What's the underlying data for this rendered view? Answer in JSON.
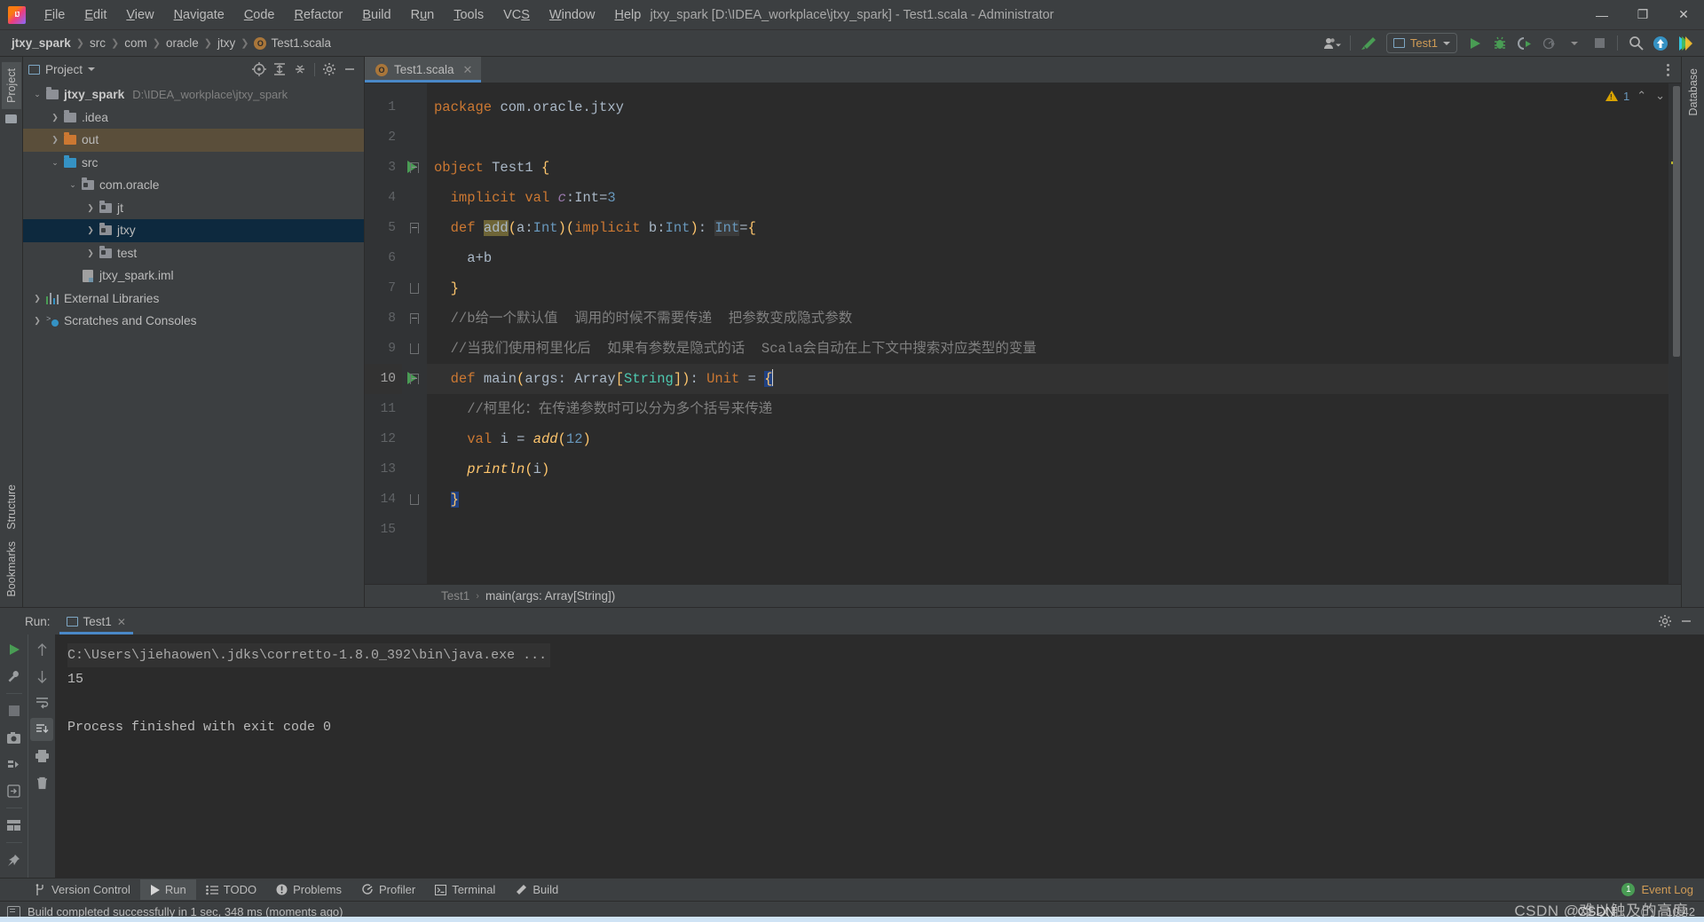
{
  "window": {
    "title": "jtxy_spark [D:\\IDEA_workplace\\jtxy_spark] - Test1.scala - Administrator",
    "minimize": "—",
    "maximize": "❐",
    "close": "✕"
  },
  "menu": [
    {
      "label": "File"
    },
    {
      "label": "Edit"
    },
    {
      "label": "View"
    },
    {
      "label": "Navigate"
    },
    {
      "label": "Code"
    },
    {
      "label": "Refactor"
    },
    {
      "label": "Build"
    },
    {
      "label": "Run"
    },
    {
      "label": "Tools"
    },
    {
      "label": "VCS"
    },
    {
      "label": "Window"
    },
    {
      "label": "Help"
    }
  ],
  "breadcrumbs": [
    {
      "label": "jtxy_spark",
      "bold": true
    },
    {
      "label": "src"
    },
    {
      "label": "com"
    },
    {
      "label": "oracle"
    },
    {
      "label": "jtxy"
    },
    {
      "label": "Test1.scala",
      "icon": "scala-object-icon"
    }
  ],
  "toolbar": {
    "account_icon": "user-account-icon",
    "hammer_icon": "build-hammer-icon",
    "run_config": "Test1",
    "run_icon": "run-icon",
    "debug_icon": "debug-icon",
    "run_coverage_icon": "run-with-coverage-icon",
    "profiler_icon": "profiler-icon",
    "stop_icon": "stop-icon",
    "search_icon": "search-everywhere-icon",
    "update_icon": "update-project-icon",
    "ide_icon": "ide-feature-icon"
  },
  "left_strip": {
    "project_tab": "Project",
    "structure_tab": "Structure",
    "bookmarks_tab": "Bookmarks"
  },
  "right_strip": {
    "database_tab": "Database"
  },
  "project_panel": {
    "title": "Project",
    "icons": [
      "locate-icon",
      "expand-all-icon",
      "collapse-all-icon",
      "settings-gear-icon",
      "hide-icon"
    ],
    "tree": [
      {
        "label": "jtxy_spark",
        "path": "D:\\IDEA_workplace\\jtxy_spark",
        "indent": 0,
        "arrow": "expanded",
        "icon": "project-folder-icon",
        "state": "normal",
        "bold": true
      },
      {
        "label": ".idea",
        "path": "",
        "indent": 1,
        "arrow": "collapsed",
        "icon": "folder-grey-icon",
        "state": "normal",
        "bold": false
      },
      {
        "label": "out",
        "path": "",
        "indent": 1,
        "arrow": "collapsed",
        "icon": "folder-orange-icon",
        "state": "highlight",
        "bold": false
      },
      {
        "label": "src",
        "path": "",
        "indent": 1,
        "arrow": "expanded",
        "icon": "folder-blue-icon",
        "state": "normal",
        "bold": false
      },
      {
        "label": "com.oracle",
        "path": "",
        "indent": 2,
        "arrow": "expanded",
        "icon": "package-icon",
        "state": "normal",
        "bold": false
      },
      {
        "label": "jt",
        "path": "",
        "indent": 3,
        "arrow": "collapsed",
        "icon": "package-icon",
        "state": "normal",
        "bold": false
      },
      {
        "label": "jtxy",
        "path": "",
        "indent": 3,
        "arrow": "collapsed",
        "icon": "package-icon",
        "state": "selected",
        "bold": false
      },
      {
        "label": "test",
        "path": "",
        "indent": 3,
        "arrow": "collapsed",
        "icon": "package-icon",
        "state": "normal",
        "bold": false
      },
      {
        "label": "jtxy_spark.iml",
        "path": "",
        "indent": 2,
        "arrow": "none",
        "icon": "iml-file-icon",
        "state": "normal",
        "bold": false
      },
      {
        "label": "External Libraries",
        "path": "",
        "indent": 0,
        "arrow": "collapsed",
        "icon": "libraries-icon",
        "state": "normal",
        "bold": false
      },
      {
        "label": "Scratches and Consoles",
        "path": "",
        "indent": 0,
        "arrow": "collapsed",
        "icon": "scratches-icon",
        "state": "normal",
        "bold": false
      }
    ]
  },
  "editor": {
    "tab": {
      "label": "Test1.scala",
      "icon": "scala-object-icon",
      "close": "✕"
    },
    "options_icon": "editor-options-icon",
    "inspection": {
      "warning_count": "1",
      "warning_icon": "warning-triangle-icon",
      "up_chevron": "⌃",
      "down_chevron": "⌄"
    },
    "breadcrumb": {
      "class": "Test1",
      "member": "main(args: Array[String])",
      "separator": "›"
    },
    "lines": [
      {
        "no": "1",
        "current": false,
        "runmark": false,
        "fold": "none"
      },
      {
        "no": "2",
        "current": false,
        "runmark": false,
        "fold": "none"
      },
      {
        "no": "3",
        "current": false,
        "runmark": true,
        "fold": "open"
      },
      {
        "no": "4",
        "current": false,
        "runmark": false,
        "fold": "none"
      },
      {
        "no": "5",
        "current": false,
        "runmark": false,
        "fold": "open"
      },
      {
        "no": "6",
        "current": false,
        "runmark": false,
        "fold": "none"
      },
      {
        "no": "7",
        "current": false,
        "runmark": false,
        "fold": "end"
      },
      {
        "no": "8",
        "current": false,
        "runmark": false,
        "fold": "open"
      },
      {
        "no": "9",
        "current": false,
        "runmark": false,
        "fold": "end"
      },
      {
        "no": "10",
        "current": true,
        "runmark": true,
        "fold": "open"
      },
      {
        "no": "11",
        "current": false,
        "runmark": false,
        "fold": "none"
      },
      {
        "no": "12",
        "current": false,
        "runmark": false,
        "fold": "none"
      },
      {
        "no": "13",
        "current": false,
        "runmark": false,
        "fold": "none"
      },
      {
        "no": "14",
        "current": false,
        "runmark": false,
        "fold": "end"
      },
      {
        "no": "15",
        "current": false,
        "runmark": false,
        "fold": "none"
      }
    ],
    "source_text": [
      "package com.oracle.jtxy",
      "",
      "object Test1 {",
      "  implicit val c:Int=3",
      "  def add(a:Int)(implicit b:Int): Int={",
      "    a+b",
      "  }",
      "  //b给一个默认值  调用的时候不需要传递  把参数变成隐式参数",
      "  //当我们使用柯里化后  如果有参数是隐式的话  Scala会自动在上下文中搜索对应类型的变量",
      "  def main(args: Array[String]): Unit = {",
      "    //柯里化：在传递参数时可以分为多个括号来传递",
      "    val i = add(12)",
      "    println(i)",
      "  }"
    ]
  },
  "run_panel": {
    "label": "Run:",
    "tab": {
      "label": "Test1",
      "icon": "run-config-icon",
      "close": "✕"
    },
    "settings_icon": "settings-gear-icon",
    "minimize_icon": "hide-icon",
    "toolbar_left": [
      "rerun-icon",
      "wrench-settings-icon",
      "stop-icon",
      "camera-snapshot-icon",
      "thread-dump-icon",
      "exit-icon",
      "layout-icon",
      "pin-icon"
    ],
    "toolbar_right": [
      "scroll-up-icon",
      "scroll-down-icon",
      "soft-wrap-icon",
      "scroll-to-end-icon",
      "print-icon",
      "trash-icon"
    ],
    "console": [
      {
        "text": "C:\\Users\\jiehaowen\\.jdks\\corretto-1.8.0_392\\bin\\java.exe ...",
        "style": "command"
      },
      {
        "text": "15",
        "style": "normal"
      },
      {
        "text": "",
        "style": "normal"
      },
      {
        "text": "Process finished with exit code 0",
        "style": "normal"
      }
    ]
  },
  "tool_window_bar": {
    "items": [
      {
        "label": "Version Control",
        "icon": "version-control-icon",
        "active": false
      },
      {
        "label": "Run",
        "icon": "run-icon",
        "active": true
      },
      {
        "label": "TODO",
        "icon": "todo-icon",
        "active": false
      },
      {
        "label": "Problems",
        "icon": "problems-icon",
        "active": false
      },
      {
        "label": "Profiler",
        "icon": "profiler-icon",
        "active": false
      },
      {
        "label": "Terminal",
        "icon": "terminal-icon",
        "active": false
      },
      {
        "label": "Build",
        "icon": "build-hammer-icon",
        "active": false
      }
    ],
    "event_log": {
      "count": "1",
      "label": "Event Log"
    }
  },
  "status_bar": {
    "message": "Build completed successfully in 1 sec, 348 ms (moments ago)",
    "icon": "status-message-icon",
    "time": "10:42",
    "clock_icon": "clock-icon"
  },
  "watermark": {
    "text": "CSDN @难以触及的高度",
    "overlay": "CSDN"
  },
  "colors": {
    "accent_blue": "#4a88c7",
    "selection_blue": "#0d293e",
    "highlight_brown": "#5a4e3a",
    "green_run": "#499c54",
    "keyword_orange": "#cc7832",
    "number_blue": "#6897bb",
    "function_yellow": "#ffc66d",
    "comment_grey": "#808080",
    "editor_bg": "#2b2b2b",
    "panel_bg": "#3c3f41"
  }
}
